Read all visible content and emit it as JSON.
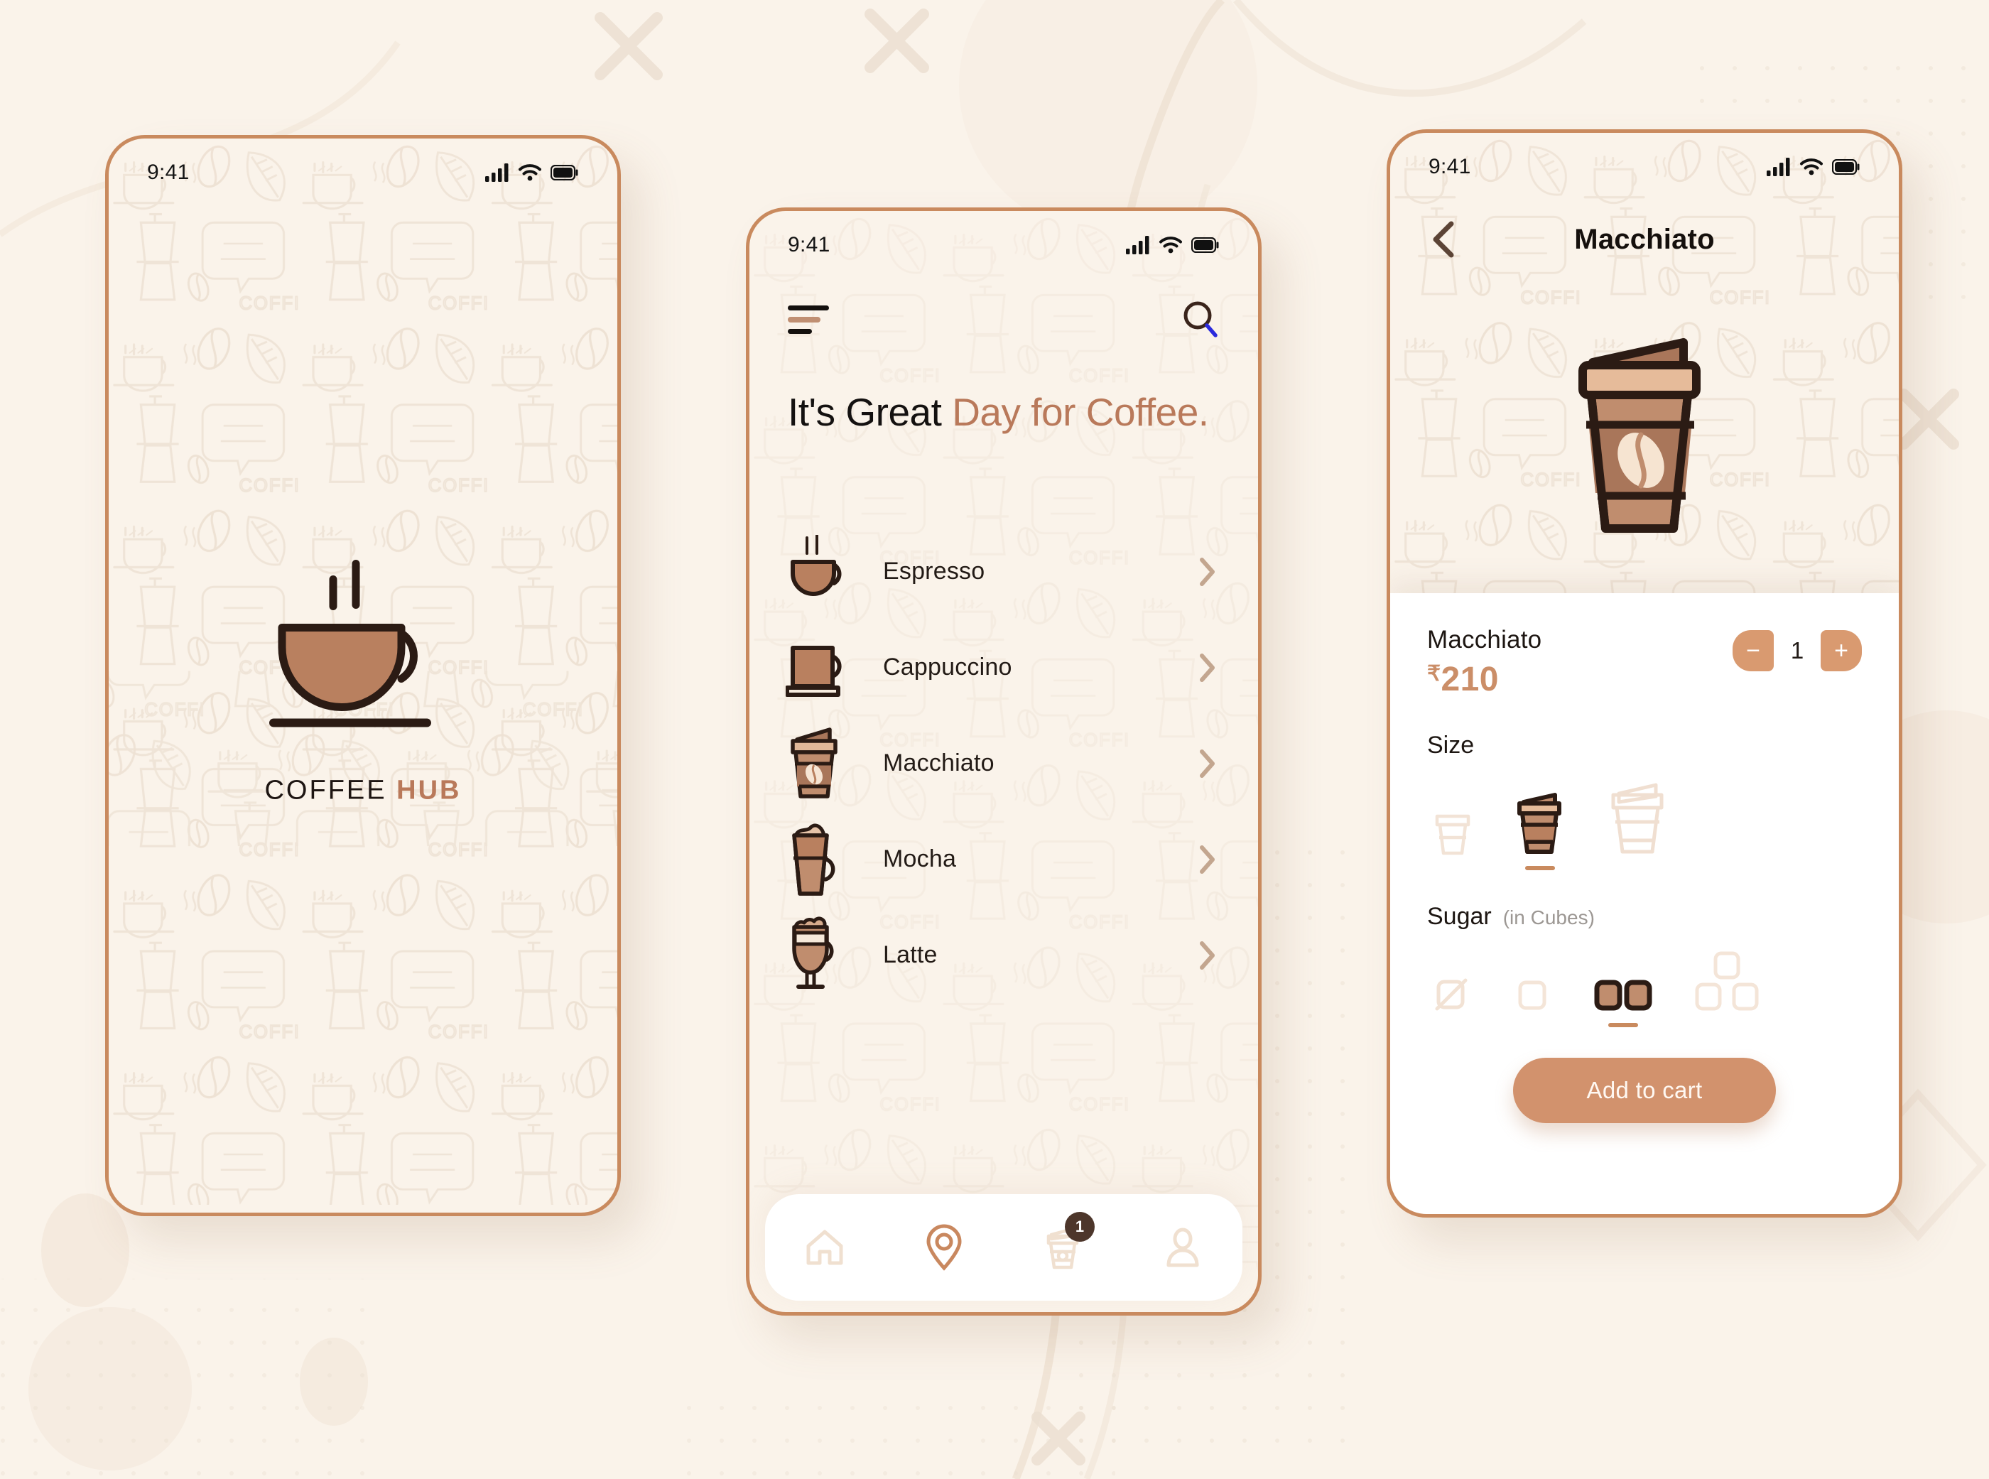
{
  "theme": {
    "page_bg": "#faf3ea",
    "frame_border": "#c98a5e",
    "accent_brown": "#b9795a",
    "accent_light": "#d2926d",
    "cup_fill": "#b9805f",
    "dark_outline": "#2b1b14",
    "sheet_bg": "#ffffff",
    "muted": "#9c9793",
    "badge_bg": "#4d362b"
  },
  "statusbar": {
    "time": "9:41",
    "icons": [
      "signal-bars-icon",
      "wifi-icon",
      "battery-icon"
    ]
  },
  "splash": {
    "logo_icon": "coffee-cup-logo-icon",
    "brand_part1": "COFFEE",
    "brand_part2": "HUB"
  },
  "home": {
    "menu_icon": "hamburger-menu-icon",
    "search_icon": "search-icon",
    "headline_plain": "It's Great ",
    "headline_accent": "Day for Coffee.",
    "headline_full": "It's Great Day for Coffee.",
    "items": [
      {
        "label": "Espresso",
        "icon": "espresso-cup-icon",
        "chevron": "chevron-right-icon"
      },
      {
        "label": "Cappuccino",
        "icon": "cappuccino-mug-icon",
        "chevron": "chevron-right-icon"
      },
      {
        "label": "Macchiato",
        "icon": "macchiato-togo-cup-icon",
        "chevron": "chevron-right-icon"
      },
      {
        "label": "Mocha",
        "icon": "mocha-glass-icon",
        "chevron": "chevron-right-icon"
      },
      {
        "label": "Latte",
        "icon": "latte-glass-icon",
        "chevron": "chevron-right-icon"
      }
    ],
    "tabs": [
      {
        "name": "home",
        "icon": "home-icon",
        "active": false,
        "badge": ""
      },
      {
        "name": "location",
        "icon": "location-pin-icon",
        "active": true,
        "badge": ""
      },
      {
        "name": "cart",
        "icon": "togo-cup-icon",
        "active": false,
        "badge": "1"
      },
      {
        "name": "profile",
        "icon": "user-icon",
        "active": false,
        "badge": ""
      }
    ]
  },
  "detail": {
    "back_icon": "chevron-left-icon",
    "title": "Macchiato",
    "hero_icon": "macchiato-togo-cup-large-icon",
    "product_name": "Macchiato",
    "currency": "₹",
    "price": "210",
    "quantity": "1",
    "minus_label": "−",
    "plus_label": "+",
    "size_label": "Size",
    "size_options": [
      {
        "name": "small",
        "icon": "cup-small-icon",
        "selected": false
      },
      {
        "name": "medium",
        "icon": "cup-medium-icon",
        "selected": true
      },
      {
        "name": "large",
        "icon": "cup-large-icon",
        "selected": false
      }
    ],
    "sugar_label": "Sugar",
    "sugar_sub": "(in Cubes)",
    "sugar_options": [
      {
        "name": "no-sugar",
        "icon": "sugar-none-icon",
        "selected": false
      },
      {
        "name": "one-cube",
        "icon": "sugar-one-cube-icon",
        "selected": false
      },
      {
        "name": "two-cubes",
        "icon": "sugar-two-cubes-icon",
        "selected": true
      },
      {
        "name": "three-cubes",
        "icon": "sugar-three-cubes-icon",
        "selected": false
      }
    ],
    "add_to_cart_label": "Add to cart"
  }
}
